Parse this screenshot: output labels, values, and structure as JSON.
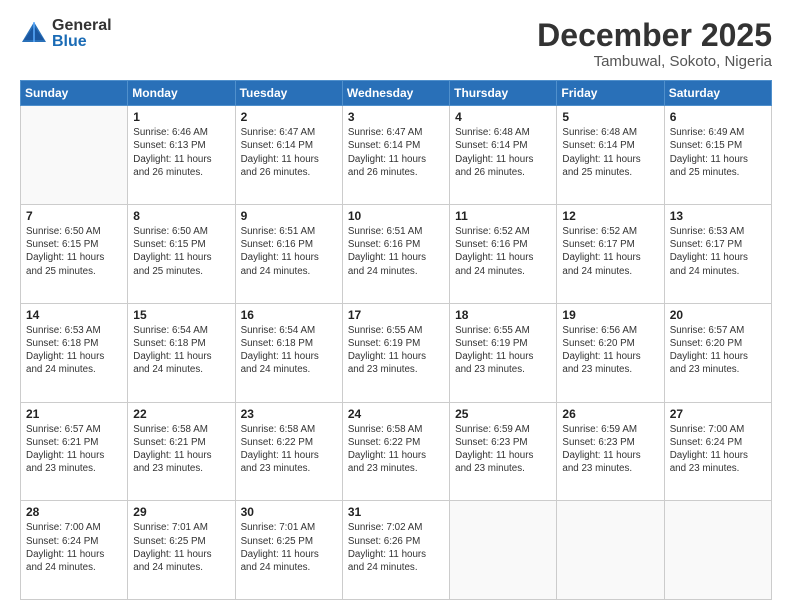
{
  "logo": {
    "general": "General",
    "blue": "Blue"
  },
  "title": "December 2025",
  "location": "Tambuwal, Sokoto, Nigeria",
  "weekdays": [
    "Sunday",
    "Monday",
    "Tuesday",
    "Wednesday",
    "Thursday",
    "Friday",
    "Saturday"
  ],
  "weeks": [
    [
      {
        "day": "",
        "info": ""
      },
      {
        "day": "1",
        "info": "Sunrise: 6:46 AM\nSunset: 6:13 PM\nDaylight: 11 hours\nand 26 minutes."
      },
      {
        "day": "2",
        "info": "Sunrise: 6:47 AM\nSunset: 6:14 PM\nDaylight: 11 hours\nand 26 minutes."
      },
      {
        "day": "3",
        "info": "Sunrise: 6:47 AM\nSunset: 6:14 PM\nDaylight: 11 hours\nand 26 minutes."
      },
      {
        "day": "4",
        "info": "Sunrise: 6:48 AM\nSunset: 6:14 PM\nDaylight: 11 hours\nand 26 minutes."
      },
      {
        "day": "5",
        "info": "Sunrise: 6:48 AM\nSunset: 6:14 PM\nDaylight: 11 hours\nand 25 minutes."
      },
      {
        "day": "6",
        "info": "Sunrise: 6:49 AM\nSunset: 6:15 PM\nDaylight: 11 hours\nand 25 minutes."
      }
    ],
    [
      {
        "day": "7",
        "info": "Sunrise: 6:50 AM\nSunset: 6:15 PM\nDaylight: 11 hours\nand 25 minutes."
      },
      {
        "day": "8",
        "info": "Sunrise: 6:50 AM\nSunset: 6:15 PM\nDaylight: 11 hours\nand 25 minutes."
      },
      {
        "day": "9",
        "info": "Sunrise: 6:51 AM\nSunset: 6:16 PM\nDaylight: 11 hours\nand 24 minutes."
      },
      {
        "day": "10",
        "info": "Sunrise: 6:51 AM\nSunset: 6:16 PM\nDaylight: 11 hours\nand 24 minutes."
      },
      {
        "day": "11",
        "info": "Sunrise: 6:52 AM\nSunset: 6:16 PM\nDaylight: 11 hours\nand 24 minutes."
      },
      {
        "day": "12",
        "info": "Sunrise: 6:52 AM\nSunset: 6:17 PM\nDaylight: 11 hours\nand 24 minutes."
      },
      {
        "day": "13",
        "info": "Sunrise: 6:53 AM\nSunset: 6:17 PM\nDaylight: 11 hours\nand 24 minutes."
      }
    ],
    [
      {
        "day": "14",
        "info": "Sunrise: 6:53 AM\nSunset: 6:18 PM\nDaylight: 11 hours\nand 24 minutes."
      },
      {
        "day": "15",
        "info": "Sunrise: 6:54 AM\nSunset: 6:18 PM\nDaylight: 11 hours\nand 24 minutes."
      },
      {
        "day": "16",
        "info": "Sunrise: 6:54 AM\nSunset: 6:18 PM\nDaylight: 11 hours\nand 24 minutes."
      },
      {
        "day": "17",
        "info": "Sunrise: 6:55 AM\nSunset: 6:19 PM\nDaylight: 11 hours\nand 23 minutes."
      },
      {
        "day": "18",
        "info": "Sunrise: 6:55 AM\nSunset: 6:19 PM\nDaylight: 11 hours\nand 23 minutes."
      },
      {
        "day": "19",
        "info": "Sunrise: 6:56 AM\nSunset: 6:20 PM\nDaylight: 11 hours\nand 23 minutes."
      },
      {
        "day": "20",
        "info": "Sunrise: 6:57 AM\nSunset: 6:20 PM\nDaylight: 11 hours\nand 23 minutes."
      }
    ],
    [
      {
        "day": "21",
        "info": "Sunrise: 6:57 AM\nSunset: 6:21 PM\nDaylight: 11 hours\nand 23 minutes."
      },
      {
        "day": "22",
        "info": "Sunrise: 6:58 AM\nSunset: 6:21 PM\nDaylight: 11 hours\nand 23 minutes."
      },
      {
        "day": "23",
        "info": "Sunrise: 6:58 AM\nSunset: 6:22 PM\nDaylight: 11 hours\nand 23 minutes."
      },
      {
        "day": "24",
        "info": "Sunrise: 6:58 AM\nSunset: 6:22 PM\nDaylight: 11 hours\nand 23 minutes."
      },
      {
        "day": "25",
        "info": "Sunrise: 6:59 AM\nSunset: 6:23 PM\nDaylight: 11 hours\nand 23 minutes."
      },
      {
        "day": "26",
        "info": "Sunrise: 6:59 AM\nSunset: 6:23 PM\nDaylight: 11 hours\nand 23 minutes."
      },
      {
        "day": "27",
        "info": "Sunrise: 7:00 AM\nSunset: 6:24 PM\nDaylight: 11 hours\nand 23 minutes."
      }
    ],
    [
      {
        "day": "28",
        "info": "Sunrise: 7:00 AM\nSunset: 6:24 PM\nDaylight: 11 hours\nand 24 minutes."
      },
      {
        "day": "29",
        "info": "Sunrise: 7:01 AM\nSunset: 6:25 PM\nDaylight: 11 hours\nand 24 minutes."
      },
      {
        "day": "30",
        "info": "Sunrise: 7:01 AM\nSunset: 6:25 PM\nDaylight: 11 hours\nand 24 minutes."
      },
      {
        "day": "31",
        "info": "Sunrise: 7:02 AM\nSunset: 6:26 PM\nDaylight: 11 hours\nand 24 minutes."
      },
      {
        "day": "",
        "info": ""
      },
      {
        "day": "",
        "info": ""
      },
      {
        "day": "",
        "info": ""
      }
    ]
  ]
}
